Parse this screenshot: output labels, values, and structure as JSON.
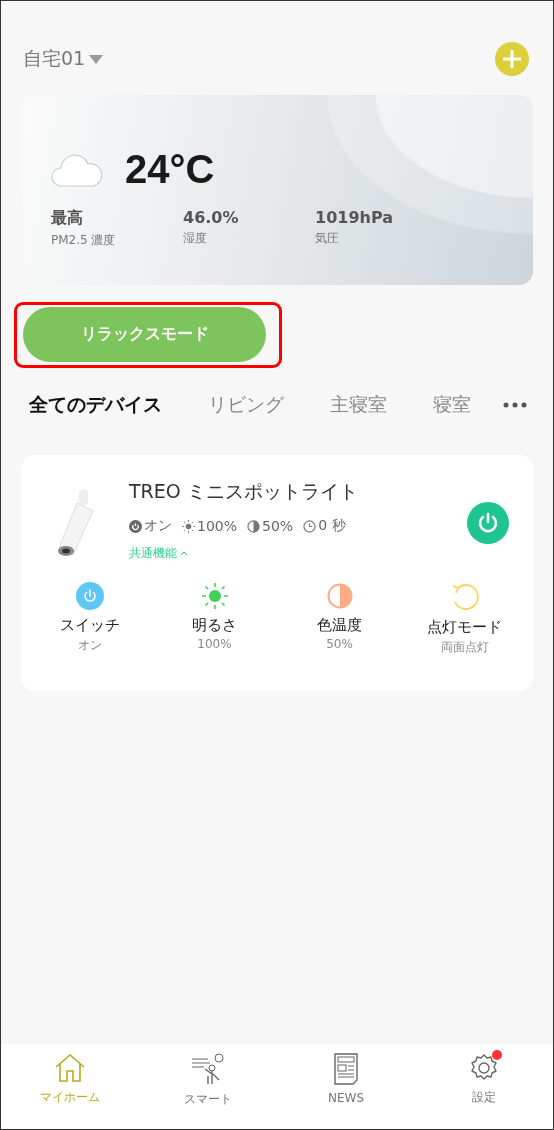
{
  "header": {
    "home_name": "自宅01"
  },
  "weather": {
    "temperature": "24°C",
    "stats": [
      {
        "value": "最高",
        "label": "PM2.5 濃度"
      },
      {
        "value": "46.0%",
        "label": "湿度"
      },
      {
        "value": "1019hPa",
        "label": "気圧"
      }
    ]
  },
  "scene_button": {
    "label": "リラックスモード",
    "highlighted": true
  },
  "tabs": [
    {
      "label": "全てのデバイス",
      "selected": true
    },
    {
      "label": "リビング",
      "selected": false
    },
    {
      "label": "主寝室",
      "selected": false
    },
    {
      "label": "寝室",
      "selected": false
    }
  ],
  "device": {
    "name": "TREO ミニスポットライト",
    "power_on": true,
    "status": [
      {
        "kind": "power",
        "text": "オン"
      },
      {
        "kind": "brightness",
        "text": "100%"
      },
      {
        "kind": "color_temp",
        "text": "50%"
      },
      {
        "kind": "timer",
        "text": "0 秒"
      }
    ],
    "common_functions": {
      "label": "共通機能",
      "expanded": true
    },
    "controls": [
      {
        "kind": "switch",
        "label": "スイッチ",
        "value": "オン"
      },
      {
        "kind": "brightness",
        "label": "明るさ",
        "value": "100%"
      },
      {
        "kind": "color_temp",
        "label": "色温度",
        "value": "50%"
      },
      {
        "kind": "mode",
        "label": "点灯モード",
        "value": "両面点灯"
      }
    ]
  },
  "nav": [
    {
      "kind": "home",
      "label": "マイホーム",
      "selected": true,
      "badge": false
    },
    {
      "kind": "smart",
      "label": "スマート",
      "selected": false,
      "badge": false
    },
    {
      "kind": "news",
      "label": "NEWS",
      "selected": false,
      "badge": false
    },
    {
      "kind": "settings",
      "label": "設定",
      "selected": false,
      "badge": true
    }
  ]
}
